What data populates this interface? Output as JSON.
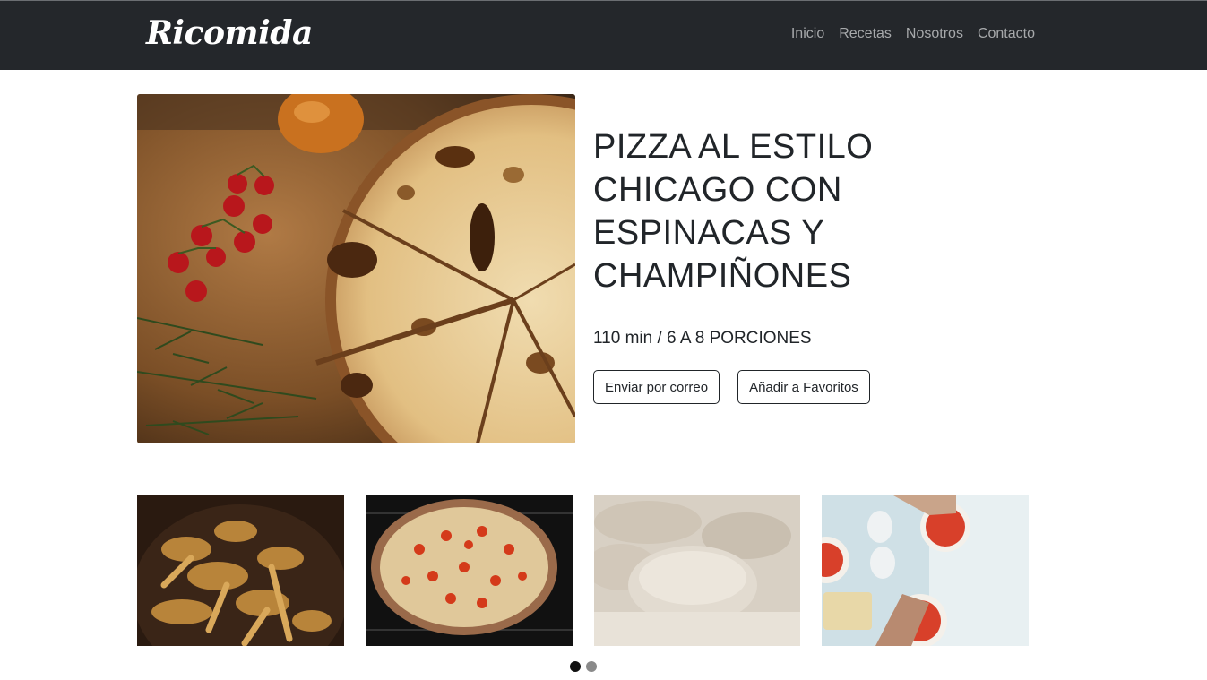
{
  "brand": {
    "name": "Ricomida"
  },
  "nav": {
    "items": [
      {
        "label": "Inicio"
      },
      {
        "label": "Recetas"
      },
      {
        "label": "Nosotros"
      },
      {
        "label": "Contacto"
      }
    ]
  },
  "recipe": {
    "title": "PIZZA AL ESTILO CHICAGO CON ESPINACAS Y CHAMPIÑONES",
    "meta": "110 min / 6 A 8 PORCIONES",
    "email_button": "Enviar por correo",
    "favorite_button": "Añadir a Favoritos"
  },
  "colors": {
    "navbar_bg": "#24272b",
    "nav_link": "#a7a9ab",
    "text": "#212529",
    "dot_active": "#111111",
    "dot_inactive": "#8a8a8a"
  },
  "gallery": {
    "images": [
      {
        "icon": "mushrooms-photo"
      },
      {
        "icon": "pizza-photo"
      },
      {
        "icon": "dough-photo"
      },
      {
        "icon": "pizza-making-photo"
      }
    ],
    "pages": 2,
    "active_page": 1
  }
}
